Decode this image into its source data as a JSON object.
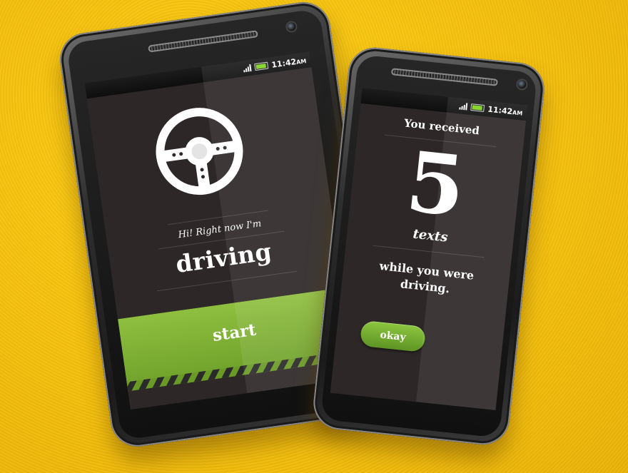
{
  "colors": {
    "background": "#f7c30e",
    "screen": "#2d2827",
    "accent_green": "#8cc63f",
    "battery": "#7ed321"
  },
  "phone_left": {
    "status_bar": {
      "time": "11:42",
      "ampm": "AM"
    },
    "wheel_icon": "steering-wheel-icon",
    "greeting": "Hi! Right now I'm",
    "status_word": "driving",
    "start_label": "start"
  },
  "phone_right": {
    "status_bar": {
      "time": "11:42",
      "ampm": "AM"
    },
    "received_label": "You received",
    "count": "5",
    "count_unit": "texts",
    "message_line1": "while you were",
    "message_line2": "driving.",
    "okay_label": "okay"
  }
}
